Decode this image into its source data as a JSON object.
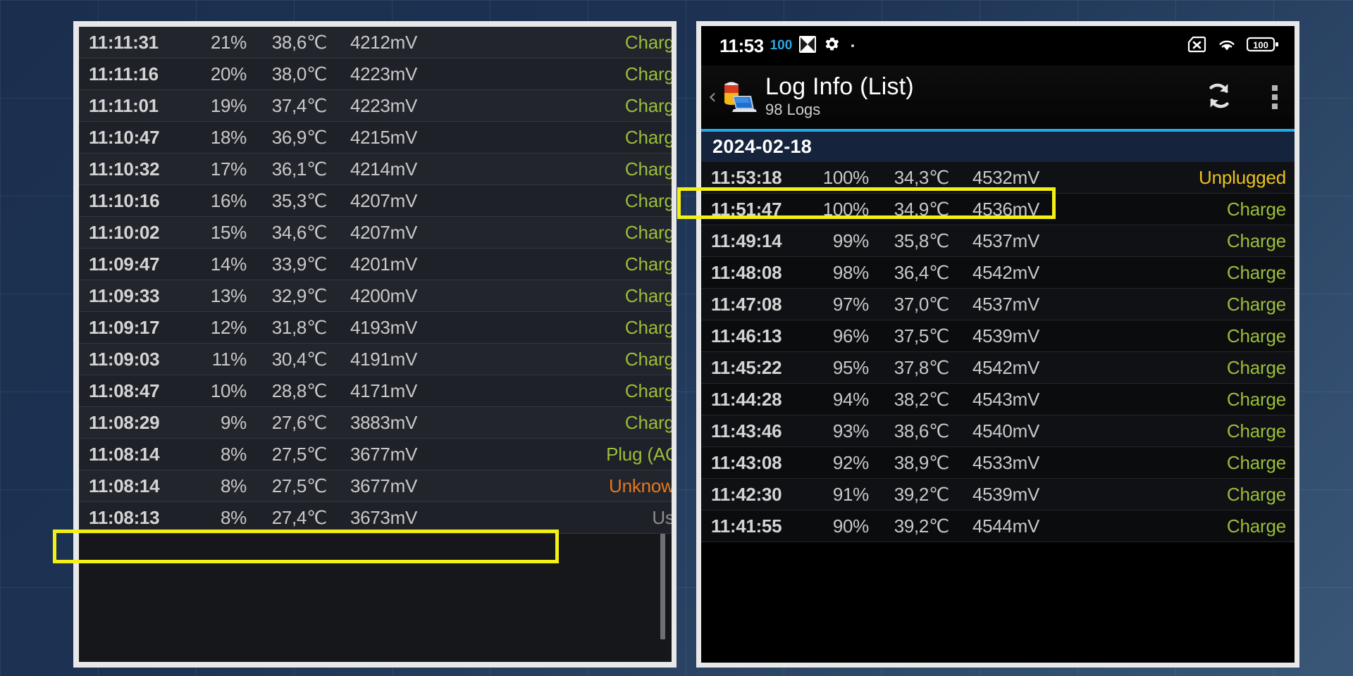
{
  "background": {
    "color_top": "#1b2e4d",
    "color_bottom": "#3a5777"
  },
  "colors": {
    "charge": "#9bbd3a",
    "unplugged": "#e8c21c",
    "unknown": "#e8761b",
    "use": "#8d8d8d",
    "accent_cyan": "#23a8e8",
    "highlight": "#f5f013",
    "status_badge_blue": "#29a8e0"
  },
  "right_panel": {
    "statusbar": {
      "clock": "11:53",
      "badge": "100",
      "icons_left": [
        "app-diamond-icon",
        "gear-icon",
        "dot-icon"
      ],
      "icons_right": [
        "no-sim-icon",
        "wifi-icon",
        "battery-icon"
      ],
      "battery_level": "100"
    },
    "actionbar": {
      "back_label": "‹",
      "app_icon": "battery-laptop-icon",
      "title": "Log Info (List)",
      "subtitle": "98 Logs",
      "refresh_icon": "refresh-icon",
      "overflow_icon": "overflow-menu-icon"
    },
    "date_header": "2024-02-18",
    "columns": [
      "time",
      "percent",
      "temperature",
      "voltage",
      "state"
    ],
    "rows": [
      {
        "time": "11:53:18",
        "percent": "100%",
        "temp": "34,3℃",
        "mv": "4532mV",
        "state": "Unplugged",
        "state_class": "st-unplugged"
      },
      {
        "time": "11:51:47",
        "percent": "100%",
        "temp": "34,9℃",
        "mv": "4536mV",
        "state": "Charge",
        "state_class": "st-charge",
        "highlighted": true
      },
      {
        "time": "11:49:14",
        "percent": "99%",
        "temp": "35,8℃",
        "mv": "4537mV",
        "state": "Charge",
        "state_class": "st-charge"
      },
      {
        "time": "11:48:08",
        "percent": "98%",
        "temp": "36,4℃",
        "mv": "4542mV",
        "state": "Charge",
        "state_class": "st-charge"
      },
      {
        "time": "11:47:08",
        "percent": "97%",
        "temp": "37,0℃",
        "mv": "4537mV",
        "state": "Charge",
        "state_class": "st-charge"
      },
      {
        "time": "11:46:13",
        "percent": "96%",
        "temp": "37,5℃",
        "mv": "4539mV",
        "state": "Charge",
        "state_class": "st-charge"
      },
      {
        "time": "11:45:22",
        "percent": "95%",
        "temp": "37,8℃",
        "mv": "4542mV",
        "state": "Charge",
        "state_class": "st-charge"
      },
      {
        "time": "11:44:28",
        "percent": "94%",
        "temp": "38,2℃",
        "mv": "4543mV",
        "state": "Charge",
        "state_class": "st-charge"
      },
      {
        "time": "11:43:46",
        "percent": "93%",
        "temp": "38,6℃",
        "mv": "4540mV",
        "state": "Charge",
        "state_class": "st-charge"
      },
      {
        "time": "11:43:08",
        "percent": "92%",
        "temp": "38,9℃",
        "mv": "4533mV",
        "state": "Charge",
        "state_class": "st-charge"
      },
      {
        "time": "11:42:30",
        "percent": "91%",
        "temp": "39,2℃",
        "mv": "4539mV",
        "state": "Charge",
        "state_class": "st-charge"
      },
      {
        "time": "11:41:55",
        "percent": "90%",
        "temp": "39,2℃",
        "mv": "4544mV",
        "state": "Charge",
        "state_class": "st-charge"
      }
    ]
  },
  "left_panel": {
    "columns": [
      "time",
      "percent",
      "temperature",
      "voltage",
      "state"
    ],
    "rows": [
      {
        "time": "11:11:31",
        "percent": "21%",
        "temp": "38,6℃",
        "mv": "4212mV",
        "state": "Charge",
        "state_class": "st-charge"
      },
      {
        "time": "11:11:16",
        "percent": "20%",
        "temp": "38,0℃",
        "mv": "4223mV",
        "state": "Charge",
        "state_class": "st-charge"
      },
      {
        "time": "11:11:01",
        "percent": "19%",
        "temp": "37,4℃",
        "mv": "4223mV",
        "state": "Charge",
        "state_class": "st-charge"
      },
      {
        "time": "11:10:47",
        "percent": "18%",
        "temp": "36,9℃",
        "mv": "4215mV",
        "state": "Charge",
        "state_class": "st-charge"
      },
      {
        "time": "11:10:32",
        "percent": "17%",
        "temp": "36,1℃",
        "mv": "4214mV",
        "state": "Charge",
        "state_class": "st-charge"
      },
      {
        "time": "11:10:16",
        "percent": "16%",
        "temp": "35,3℃",
        "mv": "4207mV",
        "state": "Charge",
        "state_class": "st-charge"
      },
      {
        "time": "11:10:02",
        "percent": "15%",
        "temp": "34,6℃",
        "mv": "4207mV",
        "state": "Charge",
        "state_class": "st-charge"
      },
      {
        "time": "11:09:47",
        "percent": "14%",
        "temp": "33,9℃",
        "mv": "4201mV",
        "state": "Charge",
        "state_class": "st-charge"
      },
      {
        "time": "11:09:33",
        "percent": "13%",
        "temp": "32,9℃",
        "mv": "4200mV",
        "state": "Charge",
        "state_class": "st-charge"
      },
      {
        "time": "11:09:17",
        "percent": "12%",
        "temp": "31,8℃",
        "mv": "4193mV",
        "state": "Charge",
        "state_class": "st-charge"
      },
      {
        "time": "11:09:03",
        "percent": "11%",
        "temp": "30,4℃",
        "mv": "4191mV",
        "state": "Charge",
        "state_class": "st-charge"
      },
      {
        "time": "11:08:47",
        "percent": "10%",
        "temp": "28,8℃",
        "mv": "4171mV",
        "state": "Charge",
        "state_class": "st-charge"
      },
      {
        "time": "11:08:29",
        "percent": "9%",
        "temp": "27,6℃",
        "mv": "3883mV",
        "state": "Charge",
        "state_class": "st-charge"
      },
      {
        "time": "11:08:14",
        "percent": "8%",
        "temp": "27,5℃",
        "mv": "3677mV",
        "state": "Plug (AC)",
        "state_class": "st-plug",
        "highlighted": true
      },
      {
        "time": "11:08:14",
        "percent": "8%",
        "temp": "27,5℃",
        "mv": "3677mV",
        "state": "Unknown",
        "state_class": "st-unknown"
      },
      {
        "time": "11:08:13",
        "percent": "8%",
        "temp": "27,4℃",
        "mv": "3673mV",
        "state": "Use",
        "state_class": "st-use"
      }
    ]
  }
}
